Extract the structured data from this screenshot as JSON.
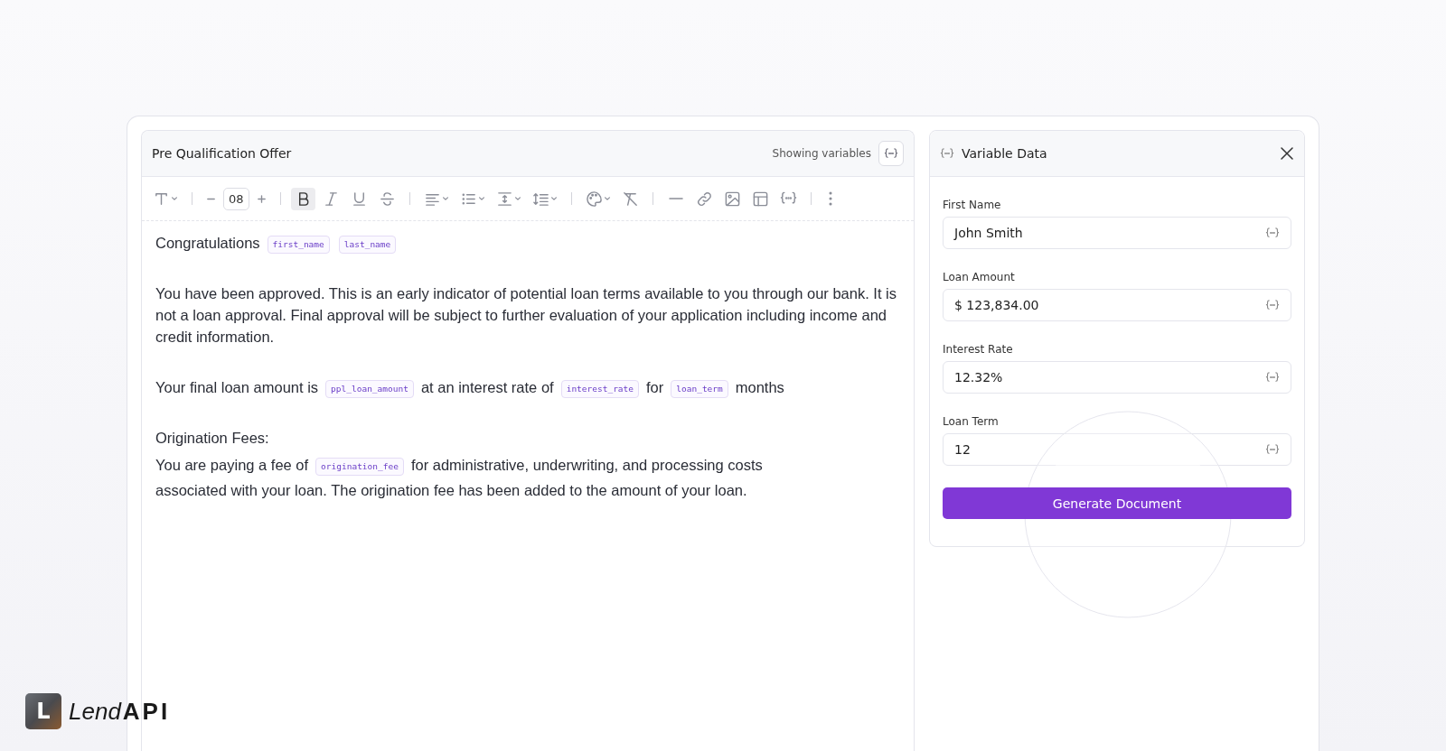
{
  "editor": {
    "title": "Pre Qualification Offer",
    "variables_label": "Showing variables",
    "variables_on": true,
    "toolbar": [
      {
        "kind": "text-style",
        "dropdown": true
      },
      {
        "kind": "sep"
      },
      {
        "kind": "minus"
      },
      {
        "kind": "size",
        "value": "08"
      },
      {
        "kind": "plus"
      },
      {
        "kind": "sep"
      },
      {
        "kind": "bold",
        "active": true
      },
      {
        "kind": "italic",
        "active": false
      },
      {
        "kind": "underline",
        "active": false
      },
      {
        "kind": "strike",
        "active": false
      },
      {
        "kind": "sep"
      },
      {
        "kind": "align",
        "dropdown": true
      },
      {
        "kind": "list",
        "dropdown": true
      },
      {
        "kind": "valign",
        "dropdown": true
      },
      {
        "kind": "lineheight",
        "dropdown": true
      },
      {
        "kind": "sep"
      },
      {
        "kind": "palette",
        "dropdown": true
      },
      {
        "kind": "clear"
      },
      {
        "kind": "sep"
      },
      {
        "kind": "rule"
      },
      {
        "kind": "link"
      },
      {
        "kind": "image"
      },
      {
        "kind": "table"
      },
      {
        "kind": "variable"
      },
      {
        "kind": "sep"
      },
      {
        "kind": "more"
      }
    ],
    "blocks": [
      {
        "kind": "para",
        "parts": [
          {
            "kind": "text",
            "text": "Congratulations"
          },
          {
            "kind": "var",
            "text": "first_name"
          },
          {
            "kind": "var",
            "text": "last_name"
          }
        ]
      },
      {
        "kind": "para",
        "parts": [
          {
            "kind": "text",
            "text": "You have been approved. This is an early indicator of potential loan terms available to you through our bank. It is not a loan approval. Final approval will be subject to further evaluation of your application including income and credit information."
          }
        ]
      },
      {
        "kind": "para",
        "parts": [
          {
            "kind": "text",
            "text": "Your final loan amount is"
          },
          {
            "kind": "var",
            "text": "ppl_loan_amount"
          },
          {
            "kind": "text",
            "text": "at an interest rate of"
          },
          {
            "kind": "var",
            "text": "interest_rate"
          },
          {
            "kind": "text",
            "text": "for"
          },
          {
            "kind": "var",
            "text": "loan_term"
          },
          {
            "kind": "text",
            "text": "months"
          }
        ]
      },
      {
        "kind": "heading",
        "parts": [
          {
            "kind": "text",
            "text": "Origination Fees:"
          }
        ]
      },
      {
        "kind": "para",
        "parts": [
          {
            "kind": "text",
            "text": "You are paying a fee of"
          },
          {
            "kind": "var",
            "text": "origination_fee"
          },
          {
            "kind": "text",
            "text": "for administrative, underwriting, and processing costs"
          },
          {
            "kind": "text",
            "text": "associated with your loan. The origination fee has been added to the amount of your loan."
          }
        ]
      }
    ]
  },
  "variable_panel": {
    "title": "Variable Data",
    "fields": [
      {
        "label": "First Name",
        "value": "John Smith"
      },
      {
        "label": "Loan Amount",
        "value": "$ 123,834.00"
      },
      {
        "label": "Interest Rate",
        "value": "12.32%"
      },
      {
        "label": "Loan Term",
        "value": "12"
      }
    ],
    "button": "Generate Document"
  },
  "logo": {
    "mark": "L",
    "word": "Lend",
    "word_bold": "API"
  }
}
